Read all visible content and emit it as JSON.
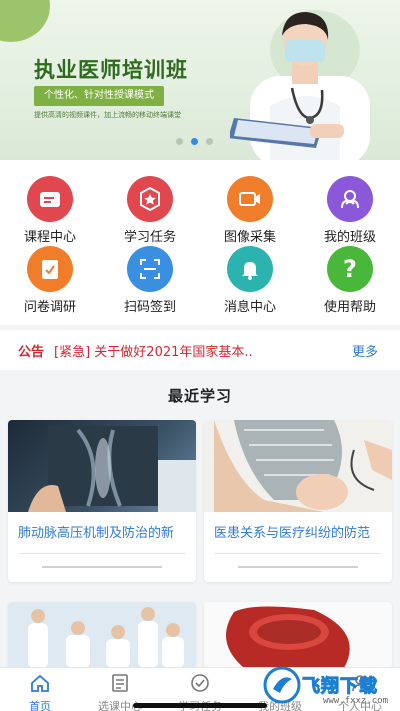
{
  "banner": {
    "title": "执业医师培训班",
    "pill": "个性化、针对性授课模式",
    "desc": "提供高清的视频课件，加上流畅的移动终端课堂",
    "dots": 3,
    "active_dot": 1
  },
  "grid": [
    {
      "label": "课程中心",
      "icon": "course-icon",
      "color": "#e0474f"
    },
    {
      "label": "学习任务",
      "icon": "task-icon",
      "color": "#e0474f"
    },
    {
      "label": "图像采集",
      "icon": "camera-icon",
      "color": "#f07d2a"
    },
    {
      "label": "我的班级",
      "icon": "class-icon",
      "color": "#8a58d8"
    },
    {
      "label": "问卷调研",
      "icon": "survey-icon",
      "color": "#f07d2a"
    },
    {
      "label": "扫码签到",
      "icon": "scan-icon",
      "color": "#3a8fe0"
    },
    {
      "label": "消息中心",
      "icon": "bell-icon",
      "color": "#2bb3b0"
    },
    {
      "label": "使用帮助",
      "icon": "help-icon",
      "color": "#49b83a"
    }
  ],
  "notice": {
    "tag": "公告",
    "text": "[紧急] 关于做好2021年国家基本..",
    "more": "更多"
  },
  "recent": {
    "title": "最近学习",
    "cards": [
      {
        "title": "肺动脉高压机制及防治的新"
      },
      {
        "title": "医患关系与医疗纠纷的防范"
      },
      {
        "title": ""
      },
      {
        "title": ""
      }
    ]
  },
  "tabbar": [
    {
      "label": "首页",
      "icon": "home-icon",
      "active": true
    },
    {
      "label": "选课中心",
      "icon": "list-icon",
      "active": false
    },
    {
      "label": "学习任务",
      "icon": "check-circle-icon",
      "active": false
    },
    {
      "label": "我的班级",
      "icon": "group-icon",
      "active": false
    },
    {
      "label": "个人中心",
      "icon": "person-icon",
      "active": false
    }
  ],
  "watermark": {
    "text": "飞翔下载",
    "url": "www.fxxz.com"
  }
}
